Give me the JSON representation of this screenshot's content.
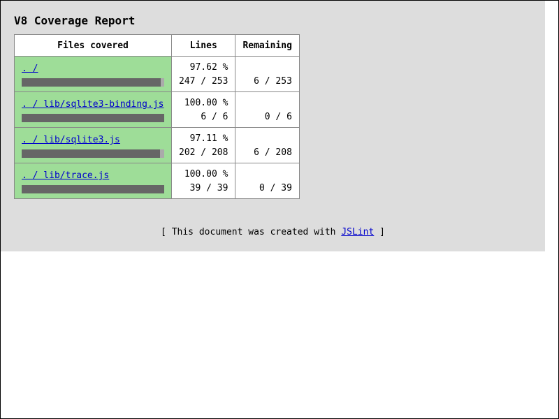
{
  "page": {
    "title": "V8 Coverage Report"
  },
  "table": {
    "headers": {
      "files": "Files covered",
      "lines": "Lines",
      "remaining": "Remaining"
    },
    "rows": [
      {
        "file": ". /",
        "percent": "97.62 %",
        "lines": "247 / 253",
        "remaining": "6 / 253",
        "coverage": 0.9762
      },
      {
        "file": ". / lib/sqlite3-binding.js",
        "percent": "100.00 %",
        "lines": "6 / 6",
        "remaining": "0 / 6",
        "coverage": 1.0
      },
      {
        "file": ". / lib/sqlite3.js",
        "percent": "97.11 %",
        "lines": "202 / 208",
        "remaining": "6 / 208",
        "coverage": 0.9711
      },
      {
        "file": ". / lib/trace.js",
        "percent": "100.00 %",
        "lines": "39 / 39",
        "remaining": "0 / 39",
        "coverage": 1.0
      }
    ]
  },
  "footer": {
    "prefix": "[ This document was created with ",
    "link": "JSLint",
    "suffix": " ]"
  },
  "colors": {
    "panel_background": "#dddddd",
    "covered_cell": "#9edd98",
    "bar_covered": "#666666",
    "bar_uncovered": "#aaaaaa",
    "link": "#0000cc"
  }
}
